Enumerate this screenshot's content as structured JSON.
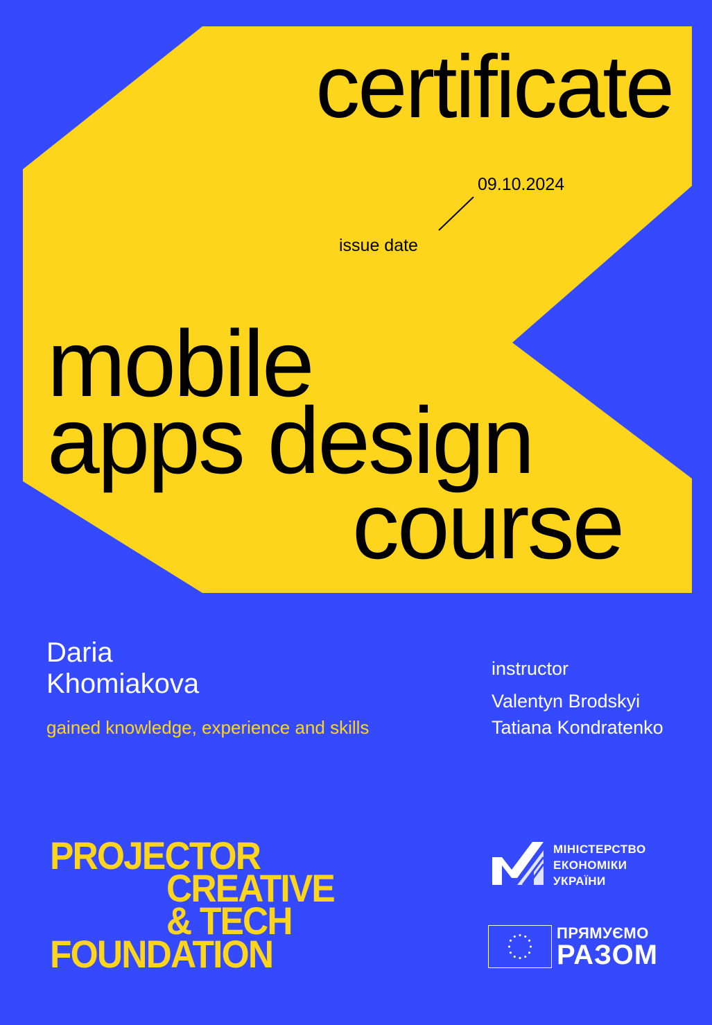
{
  "colors": {
    "background": "#3549fd",
    "accent": "#fcd51c",
    "text_dark": "#000000",
    "text_light": "#ffffff"
  },
  "certificate": {
    "title": "certificate",
    "issue_date_value": "09.10.2024",
    "issue_date_label": "issue date",
    "course_lines": [
      "mobile",
      "apps design",
      "course"
    ]
  },
  "recipient": {
    "first_name": "Daria",
    "last_name": "Khomiakova",
    "statement": "gained knowledge, experience and skills"
  },
  "instructors": {
    "label": "instructor",
    "names": [
      "Valentyn Brodskyi",
      "Tatiana Kondratenko"
    ]
  },
  "logos": {
    "projector": [
      "PROJECTOR",
      "CREATIVE",
      "& TECH",
      "FOUNDATION"
    ],
    "ministry": [
      "МІНІСТЕРСТВО",
      "ЕКОНОМІКИ",
      "УКРАЇНИ"
    ],
    "ministry_icon": "ministry-m-icon",
    "eu_icon": "eu-flag-icon",
    "pryamuemo": "ПРЯМУЄМО",
    "razom": "РАЗОМ"
  }
}
